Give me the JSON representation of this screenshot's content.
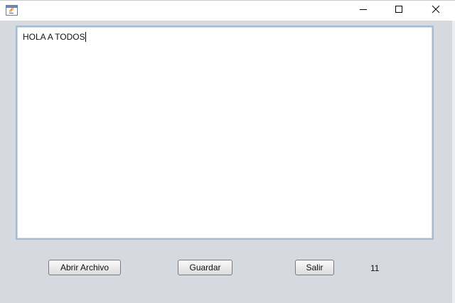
{
  "window": {
    "app_icon": "java-coffee-cup-icon",
    "minimize_icon": "minimize-icon",
    "maximize_icon": "maximize-icon",
    "close_icon": "close-icon"
  },
  "editor": {
    "text": "HOLA A TODOS",
    "caret_visible": true
  },
  "buttons": {
    "open_label": "Abrir Archivo",
    "save_label": "Guardar",
    "exit_label": "Salir"
  },
  "status": {
    "count": "11"
  },
  "colors": {
    "background": "#d6d9df",
    "text_area_border": "#a6bcd3",
    "titlebar": "#ffffff"
  }
}
